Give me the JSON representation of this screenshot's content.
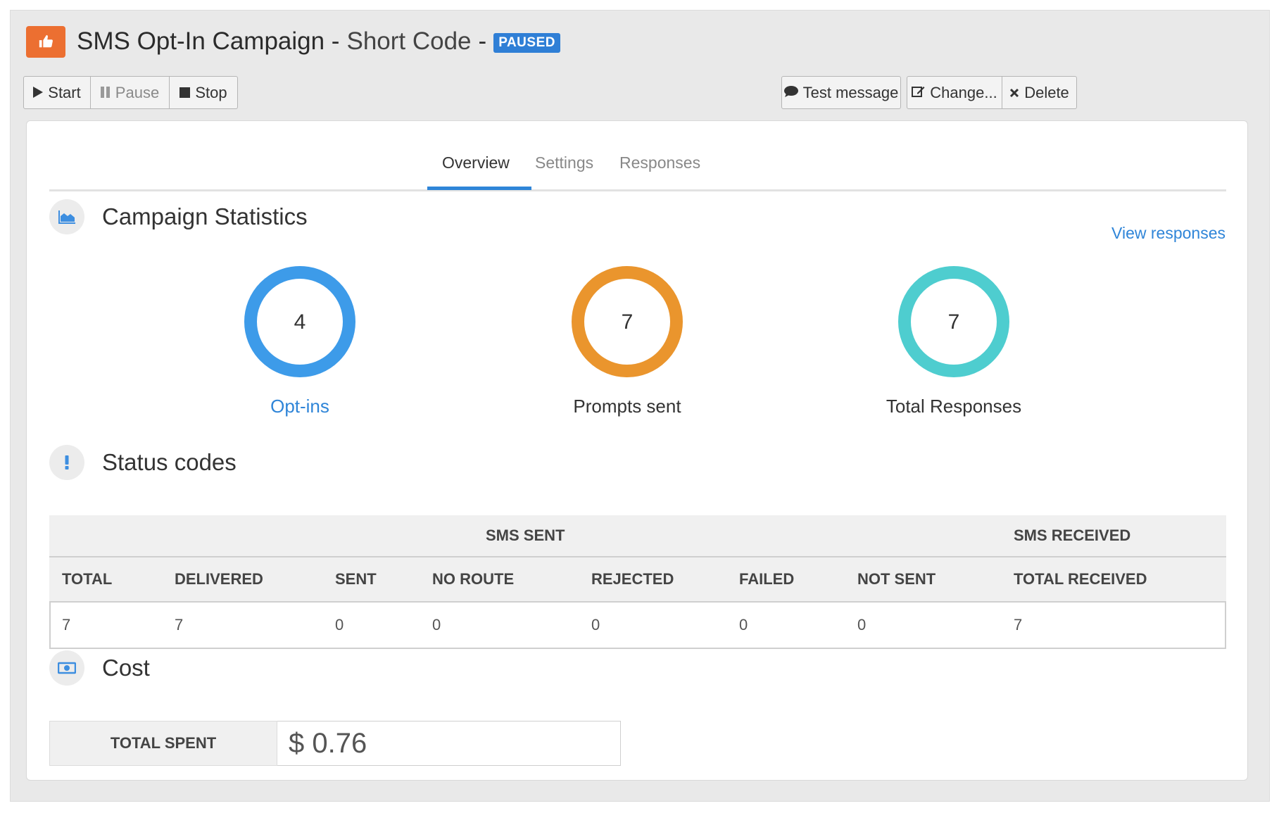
{
  "header": {
    "title": "SMS Opt-In Campaign -",
    "subtitle": "Short Code",
    "dash": "-",
    "status_badge": "PAUSED",
    "icon": "thumbs-up-icon",
    "accent_color": "#ec6f31",
    "badge_color": "#2f7fd6"
  },
  "toolbar": {
    "start_label": "Start",
    "pause_label": "Pause",
    "stop_label": "Stop",
    "test_label": "Test message",
    "change_label": "Change...",
    "delete_label": "Delete"
  },
  "tabs": [
    {
      "label": "Overview",
      "active": true
    },
    {
      "label": "Settings",
      "active": false
    },
    {
      "label": "Responses",
      "active": false
    }
  ],
  "statistics": {
    "title": "Campaign Statistics",
    "view_link": "View responses",
    "items": [
      {
        "value": "4",
        "label": "Opt-ins",
        "color": "#3d9be9"
      },
      {
        "value": "7",
        "label": "Prompts sent",
        "color": "#ea952d"
      },
      {
        "value": "7",
        "label": "Total Responses",
        "color": "#4ecdcf"
      }
    ]
  },
  "status_codes": {
    "title": "Status codes",
    "group_headers": [
      "SMS SENT",
      "SMS RECEIVED"
    ],
    "columns": [
      "TOTAL",
      "DELIVERED",
      "SENT",
      "NO ROUTE",
      "REJECTED",
      "FAILED",
      "NOT SENT",
      "TOTAL RECEIVED"
    ],
    "values": [
      "7",
      "7",
      "0",
      "0",
      "0",
      "0",
      "0",
      "7"
    ]
  },
  "cost": {
    "title": "Cost",
    "label": "TOTAL SPENT",
    "value": "$ 0.76"
  }
}
